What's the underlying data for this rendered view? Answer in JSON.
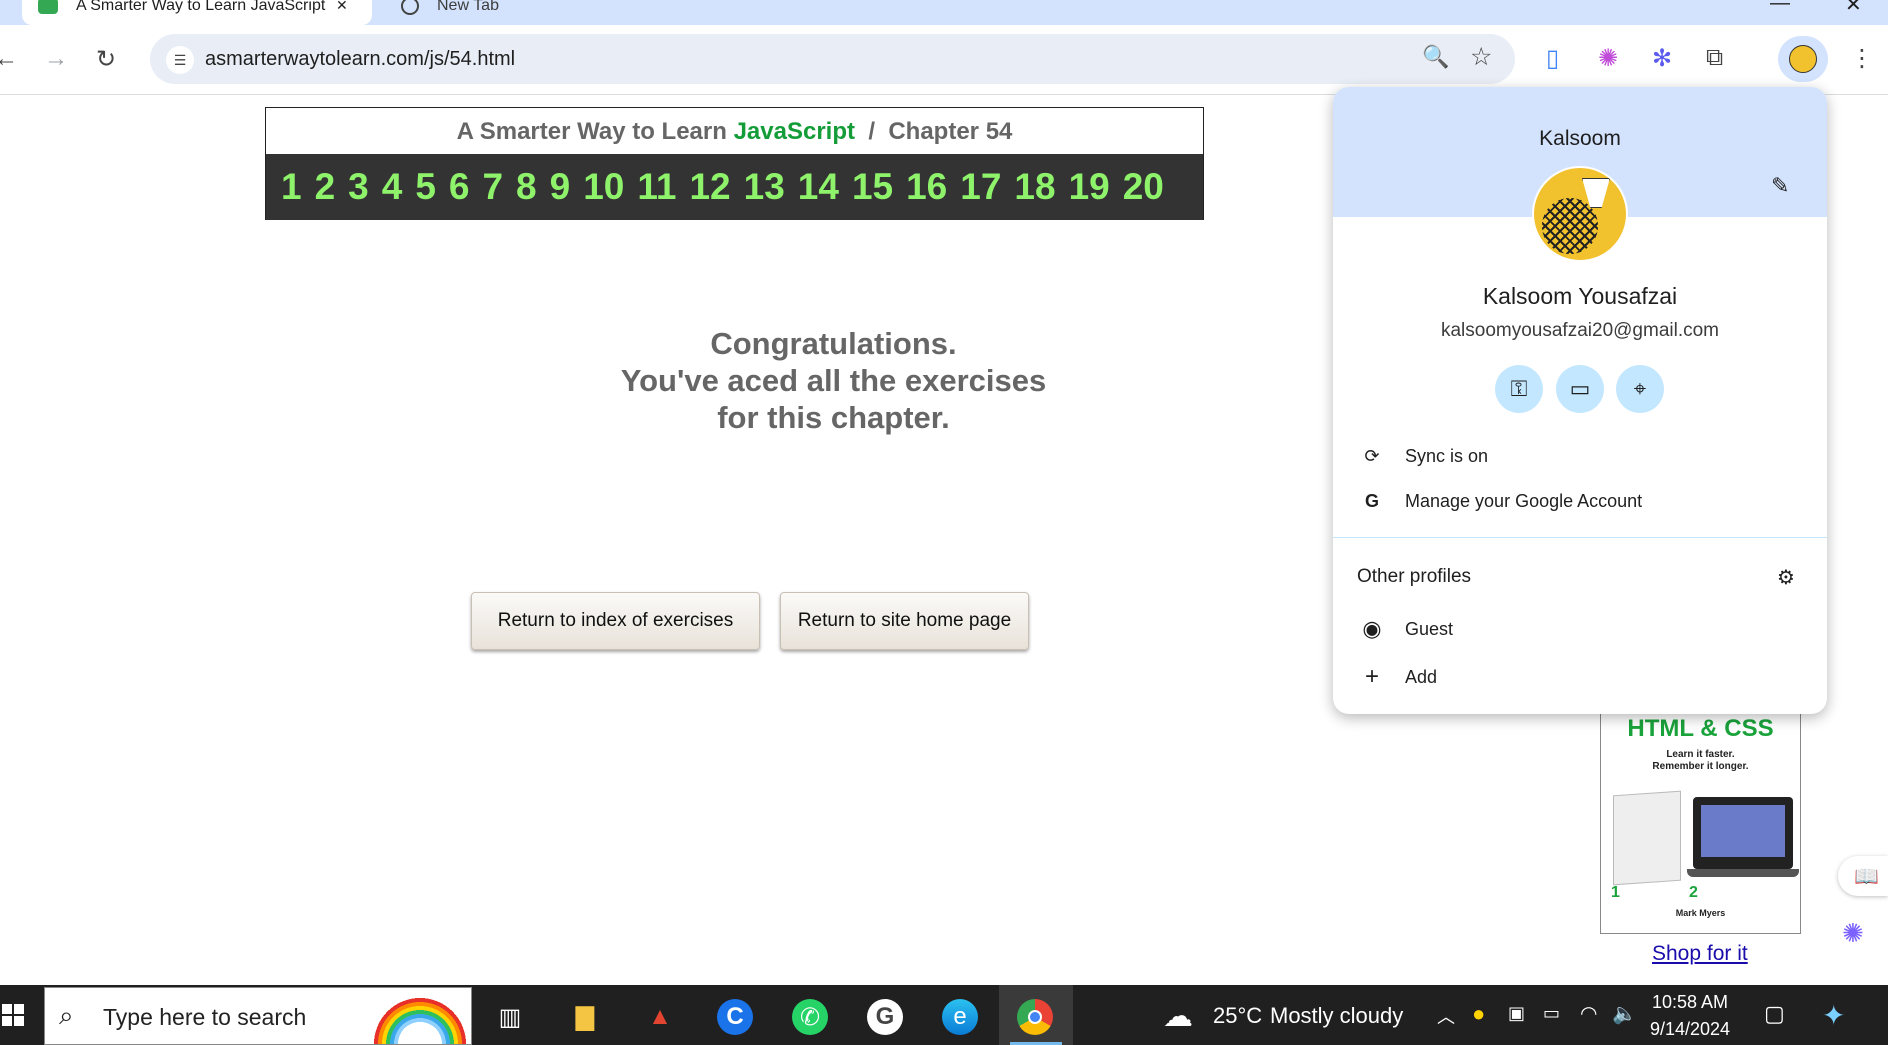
{
  "browser": {
    "tabs": [
      {
        "title": "A Smarter Way to Learn JavaScript",
        "active": true
      },
      {
        "title": "New Tab",
        "active": false
      }
    ],
    "url": "asmarterwaytolearn.com/js/54.html"
  },
  "page": {
    "site_title_prefix": "A Smarter Way to Learn",
    "site_title_js": "JavaScript",
    "site_title_sep": "/",
    "site_title_chapter": "Chapter 54",
    "chapters": [
      "1",
      "2",
      "3",
      "4",
      "5",
      "6",
      "7",
      "8",
      "9",
      "10",
      "11",
      "12",
      "13",
      "14",
      "15",
      "16",
      "17",
      "18",
      "19",
      "20"
    ],
    "congrats_line1": "Congratulations.",
    "congrats_line2": "You've aced all the exercises",
    "congrats_line3": "for this chapter.",
    "button_index": "Return to index of exercises",
    "button_home": "Return to site home page",
    "ad": {
      "title": "HTML & CSS",
      "subtitle_1": "Learn it faster.",
      "subtitle_2": "Remember it longer.",
      "step1": "1",
      "step2": "2",
      "author": "Mark Myers",
      "shop_link": "Shop for it"
    }
  },
  "profile_menu": {
    "profile_name": "Kalsoom",
    "full_name": "Kalsoom Yousafzai",
    "email": "kalsoomyousafzai20@gmail.com",
    "sync": "Sync is on",
    "manage": "Manage your Google Account",
    "other_profiles": "Other profiles",
    "guest": "Guest",
    "add": "Add"
  },
  "taskbar": {
    "search_placeholder": "Type here to search",
    "temperature": "25°C",
    "weather": "Mostly cloudy",
    "time": "10:58 AM",
    "date": "9/14/2024"
  }
}
